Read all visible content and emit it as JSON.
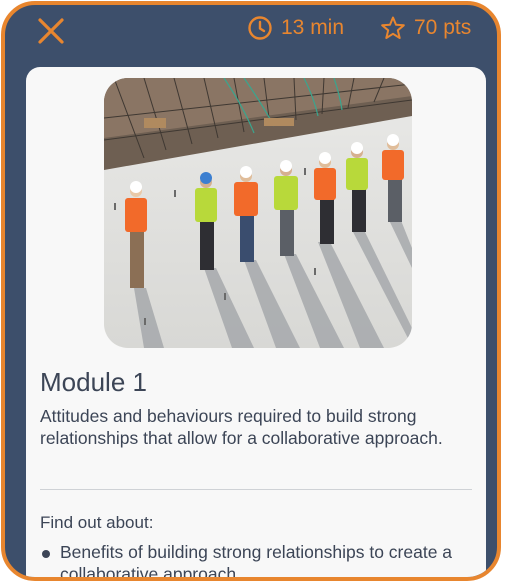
{
  "header": {
    "close_icon": "close-x-icon",
    "time": {
      "icon": "clock-icon",
      "label": "13 min"
    },
    "points": {
      "icon": "star-outline-icon",
      "label": "70 pts"
    }
  },
  "module": {
    "image_alt": "Construction workers in hi-vis vests standing on a concrete slab",
    "title": "Module 1",
    "description": "Attitudes and behaviours required to build strong relationships that allow for a collaborative approach.",
    "find_out_label": "Find out about:",
    "bullets": [
      "Benefits of building strong relationships to create a collaborative approach."
    ]
  },
  "colors": {
    "accent": "#e8862f",
    "background": "#3d4f6b",
    "card": "#f8f8f8",
    "text": "#3c4556"
  }
}
